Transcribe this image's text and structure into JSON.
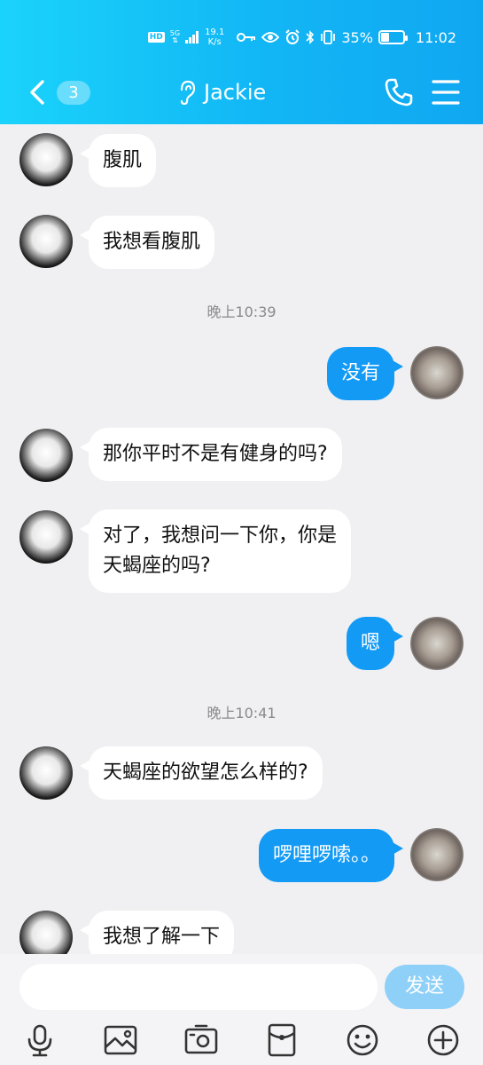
{
  "status_bar": {
    "net_type": "5G",
    "speed_value": "19.1",
    "speed_unit": "K/s",
    "battery": "35%",
    "time": "11:02"
  },
  "header": {
    "unread_count": "3",
    "contact_name": "Jackie"
  },
  "messages": [
    {
      "side": "in",
      "text": "腹肌"
    },
    {
      "side": "in",
      "text": "我想看腹肌"
    },
    {
      "time": "晚上10:39"
    },
    {
      "side": "out",
      "text": "没有"
    },
    {
      "side": "in",
      "text": "那你平时不是有健身的吗?"
    },
    {
      "side": "in",
      "text_lines": [
        "对了，我想问一下你，你是",
        "天蝎座的吗?"
      ]
    },
    {
      "side": "out",
      "text": "嗯"
    },
    {
      "time": "晚上10:41"
    },
    {
      "side": "in",
      "text": "天蝎座的欲望怎么样的?"
    },
    {
      "side": "out",
      "text": "啰哩啰嗦。。"
    },
    {
      "side": "in",
      "text": "我想了解一下"
    }
  ],
  "input": {
    "placeholder": "",
    "send_label": "发送"
  },
  "toolbar": [
    "microphone-icon",
    "image-icon",
    "camera-icon",
    "red-packet-icon",
    "emoji-icon",
    "plus-icon"
  ],
  "colors": {
    "header_start": "#1ad3fb",
    "header_end": "#10a7f1",
    "outgoing_bubble": "#139af5",
    "send_button": "#8fd0f8"
  }
}
